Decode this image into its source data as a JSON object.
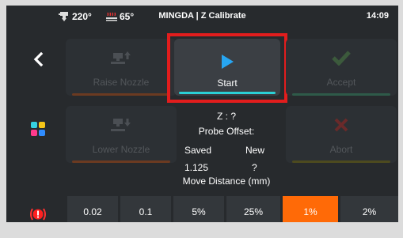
{
  "status": {
    "nozzle_temp": "220°",
    "bed_temp": "65°",
    "title": "MINGDA | Z Calibrate",
    "time": "14:09"
  },
  "actions": {
    "raise": "Raise Nozzle",
    "lower": "Lower Nozzle",
    "start": "Start",
    "accept": "Accept",
    "abort": "Abort"
  },
  "info": {
    "z": "Z : ?",
    "probe_offset": "Probe Offset:",
    "saved_label": "Saved",
    "new_label": "New",
    "saved_value": "1.125",
    "new_value": "?",
    "move_distance": "Move Distance (mm)"
  },
  "distances": [
    "0.02",
    "0.1",
    "5%",
    "25%",
    "1%",
    "2%"
  ],
  "selected_distance": "1%",
  "colors": {
    "accent_orange": "#ff6a07",
    "start_bar": "#2bd0d6",
    "highlight": "#e21d1d"
  }
}
